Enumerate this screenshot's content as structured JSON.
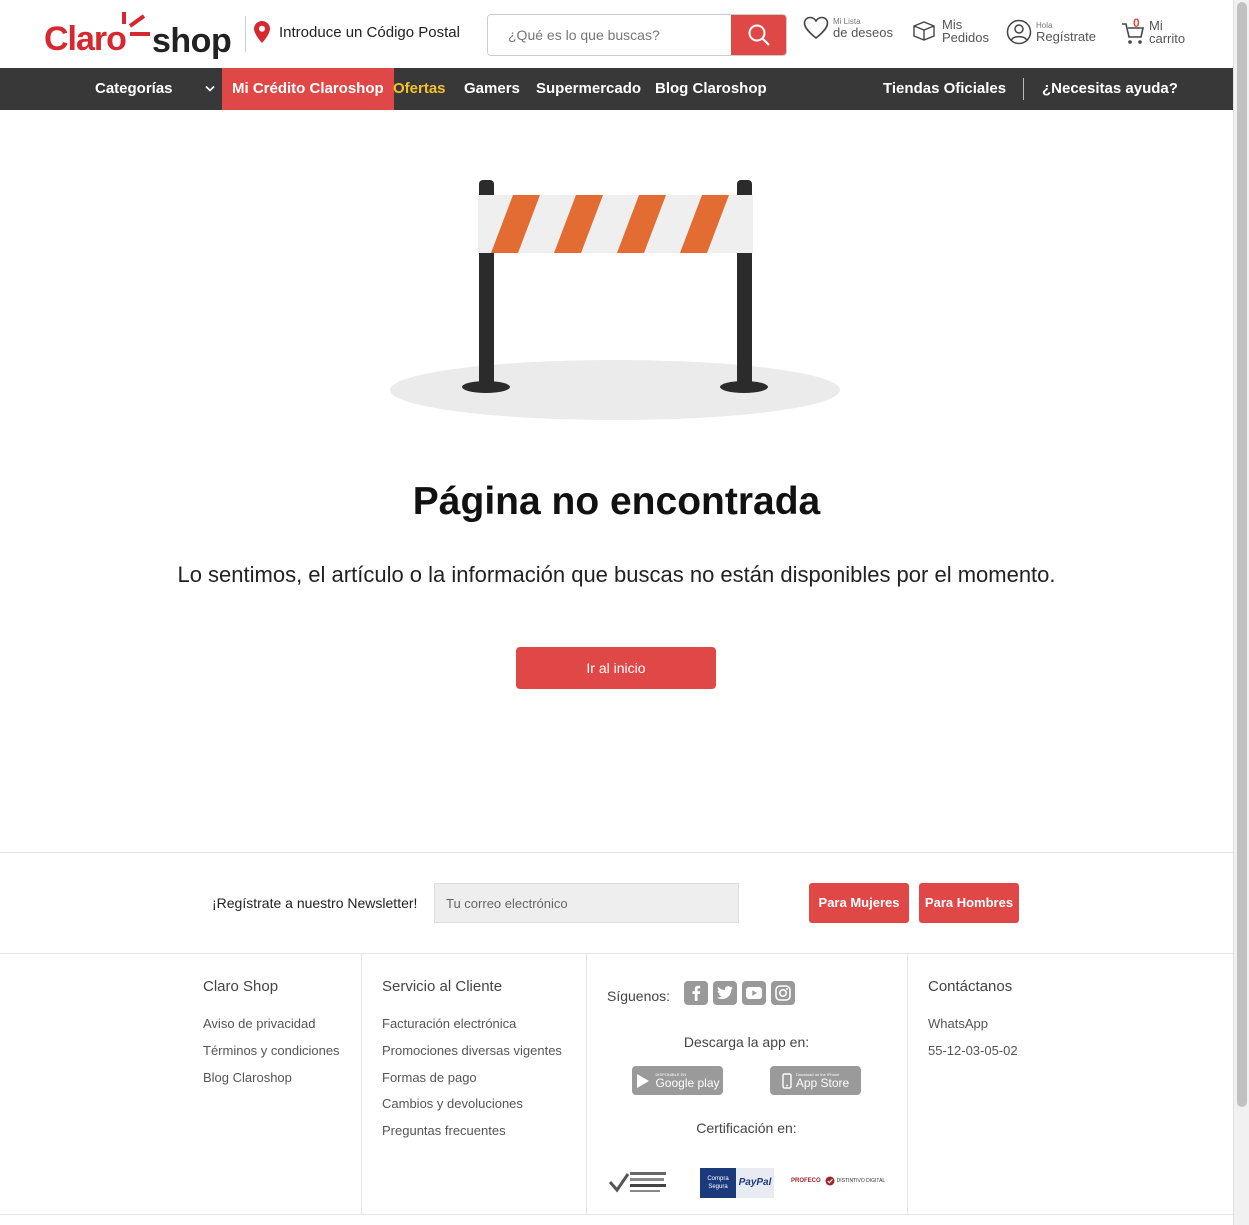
{
  "header": {
    "logo_claro": "Claro",
    "logo_shop": "shop",
    "postal_label": "Introduce un Código Postal",
    "search_placeholder": "¿Qué es lo que buscas?",
    "wishlist_small": "Mi Lista",
    "wishlist_big": "de deseos",
    "orders_small": "Mis",
    "orders_big": "Pedidos",
    "account_small": "Hola",
    "account_big": "Regístrate",
    "cart_count": "0",
    "cart_small": "Mi",
    "cart_big": "carrito"
  },
  "nav": {
    "categories": "Categorías",
    "credit": "Mi Crédito Claroshop",
    "offers": "Ofertas",
    "gamers": "Gamers",
    "supermarket": "Supermercado",
    "blog": "Blog Claroshop",
    "official_stores": "Tiendas Oficiales",
    "help": "¿Necesitas ayuda?"
  },
  "main": {
    "title": "Página no encontrada",
    "message": "Lo sentimos, el artículo o la información que buscas no están disponibles por el momento.",
    "home_button": "Ir al inicio"
  },
  "newsletter": {
    "label": "¡Regístrate a nuestro Newsletter!",
    "placeholder": "Tu correo electrónico",
    "women_button": "Para Mujeres",
    "men_button": "Para Hombres"
  },
  "footer": {
    "col1_title": "Claro Shop",
    "col1_links": [
      "Aviso de privacidad",
      "Términos y condiciones",
      "Blog Claroshop"
    ],
    "col2_title": "Servicio al Cliente",
    "col2_links": [
      "Facturación electrónica",
      "Promociones diversas vigentes",
      "Formas de pago",
      "Cambios y devoluciones",
      "Preguntas frecuentes"
    ],
    "follow_label": "Síguenos:",
    "download_label": "Descarga la app en:",
    "google_play_small": "DISPONIBLE EN",
    "google_play": "Google play",
    "app_store_small": "Download on the iPhone",
    "app_store": "App Store",
    "certification_label": "Certificación en:",
    "cert_paypal_small": "Compra Segura",
    "cert_paypal": "PayPal",
    "cert_profeco": "PROFECO",
    "cert_profeco_2": "DISTINTIVO DIGITAL",
    "col4_title": "Contáctanos",
    "contact_whatsapp": "WhatsApp",
    "contact_phone": "55-12-03-05-02"
  },
  "colors": {
    "brand_red": "#e04848",
    "nav_bg": "#383838",
    "offers_yellow": "#f5c22a",
    "barrier_orange": "#e36c33"
  }
}
